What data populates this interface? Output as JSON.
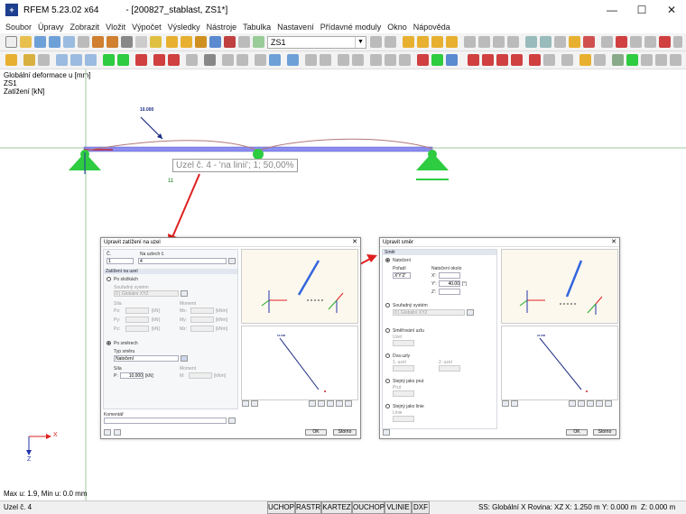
{
  "app": {
    "name": "RFEM 5.23.02 x64",
    "document": "- [200827_stablast, ZS1*]"
  },
  "window_buttons": {
    "minimize": "—",
    "maximize": "☐",
    "close": "✕"
  },
  "menu": [
    "Soubor",
    "Úpravy",
    "Zobrazit",
    "Vložit",
    "Výpočet",
    "Výsledky",
    "Nástroje",
    "Tabulka",
    "Nastavení",
    "Přídavné moduly",
    "Okno",
    "Nápověda"
  ],
  "toolbar": {
    "load_case": "ZS1"
  },
  "view_info": {
    "line1": "Globální deformace u [mm]",
    "line2": "ZS1",
    "line3": "Zatížení [kN]"
  },
  "model": {
    "load_value": "10.000",
    "node_label": "11",
    "tooltip": "Uzel č. 4 - 'na linii'; 1; 50,00%"
  },
  "coords": {
    "x": "X",
    "z": "Z"
  },
  "max_min": "Max u: 1.9, Min u: 0.0 mm",
  "status": {
    "left": "Uzel č. 4",
    "buttons": [
      "UCHOP",
      "RASTR",
      "KARTEZ",
      "OUCHOP",
      "VLINIE",
      "DXF"
    ],
    "plane": "SS: Globální X Rovina: XZ",
    "x": "X: 1.250 m",
    "y": "Y: 0.000 m",
    "z": "Z: 0.000 m"
  },
  "dialog1": {
    "title": "Upravit zatížení na uzel",
    "no_label": "Č.",
    "no_value": "1",
    "nodes_label": "Na uzlech č.",
    "nodes_value": "4",
    "section_load": "Zatížení na uzel",
    "opt_system": "Po složkách",
    "cs_label": "Souřadný systém",
    "cs_value": "0 | Globální XYZ",
    "forces_label": "Síla",
    "moments_label": "Moment",
    "fx": "Px:",
    "fy": "Py:",
    "fz": "Pz:",
    "mx": "Mx:",
    "my": "My:",
    "mz": "Mz:",
    "unit_kn": "[kN]",
    "unit_knm": "[kNm]",
    "opt_direction": "Po směrech",
    "dir_type_label": "Typ směru",
    "dir_type_value": "Natočení",
    "force_label": "Síla",
    "force_sym": "P:",
    "force_value": "10.000",
    "moment2_label": "Moment",
    "moment2_sym": "M:",
    "comment_label": "Komentář",
    "ok": "OK",
    "cancel": "Storno",
    "preview_load": "10.000"
  },
  "dialog2": {
    "title": "Upravit směr",
    "section_dir": "Směr",
    "opt_rotation": "Natočení",
    "order_label": "Pořadí",
    "order_value": "X'Y'Z'",
    "rot_label": "Natočení okolo",
    "rx": "X':",
    "ry": "Y':",
    "rz": "Z':",
    "ry_value": "40.00",
    "unit_deg": "[°]",
    "opt_cs": "Souřadný systém",
    "cs_value": "0 | Globální XYZ",
    "opt_node": "Směřování uzlu",
    "opt_two_nodes": "Dva uzly",
    "opt_member": "Stejný jako prut",
    "opt_line": "Stejný jako linie",
    "node_lbl": "Uzel",
    "node1": "1. uzel",
    "node2": "2. uzel",
    "member_lbl": "Prut",
    "line_lbl": "Linie",
    "ok": "OK",
    "cancel": "Storno",
    "preview_load": "10.000"
  },
  "colors": {
    "beam": "#8a8cf0",
    "support": "#2ecc40",
    "arrow": "#e02020",
    "axis_x": "#dd2222",
    "axis_z": "#2233aa"
  }
}
